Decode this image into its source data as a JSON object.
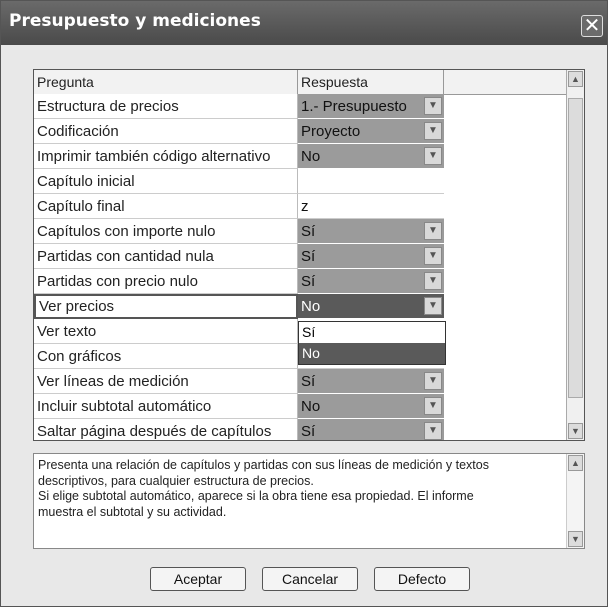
{
  "window": {
    "title": "Presupuesto y mediciones",
    "close_glyph": "✕"
  },
  "grid": {
    "headers": [
      "Pregunta",
      "Respuesta"
    ],
    "rows": [
      {
        "q": "Estructura de precios",
        "a": "1.- Presupuesto",
        "dd": true
      },
      {
        "q": "Codificación",
        "a": "Proyecto",
        "dd": true
      },
      {
        "q": "Imprimir también código alternativo",
        "a": "No",
        "dd": true
      },
      {
        "q": "Capítulo inicial",
        "a": "",
        "dd": false
      },
      {
        "q": "Capítulo final",
        "a": "z",
        "dd": false
      },
      {
        "q": "Capítulos con importe nulo",
        "a": "Sí",
        "dd": true
      },
      {
        "q": "Partidas con cantidad nula",
        "a": "Sí",
        "dd": true
      },
      {
        "q": "Partidas con precio nulo",
        "a": "Sí",
        "dd": true
      },
      {
        "q": "Ver precios",
        "a": "No",
        "dd": true,
        "selected": true
      },
      {
        "q": "Ver texto",
        "a": "",
        "dd": false
      },
      {
        "q": "Con gráficos",
        "a": "",
        "dd": false
      },
      {
        "q": "Ver líneas de medición",
        "a": "Sí",
        "dd": true
      },
      {
        "q": "Incluir subtotal automático",
        "a": "No",
        "dd": true
      },
      {
        "q": "Saltar página después de capítulos",
        "a": "Sí",
        "dd": true
      }
    ],
    "dropdown_options": [
      "Sí",
      "No"
    ],
    "dropdown_selected": "No"
  },
  "description": {
    "lines": [
      "Presenta una relación de capítulos y partidas con sus líneas de medición y textos",
      "descriptivos, para cualquier estructura de precios.",
      "Si elige subtotal automático, aparece si la obra tiene esa propiedad. El informe",
      "muestra el subtotal y su actividad."
    ]
  },
  "buttons": {
    "accept": "Aceptar",
    "cancel": "Cancelar",
    "default": "Defecto"
  },
  "colors": {
    "titlebar": "#555555",
    "answer_cell": "#9b9b9b",
    "selected": "#5a5a5a"
  }
}
